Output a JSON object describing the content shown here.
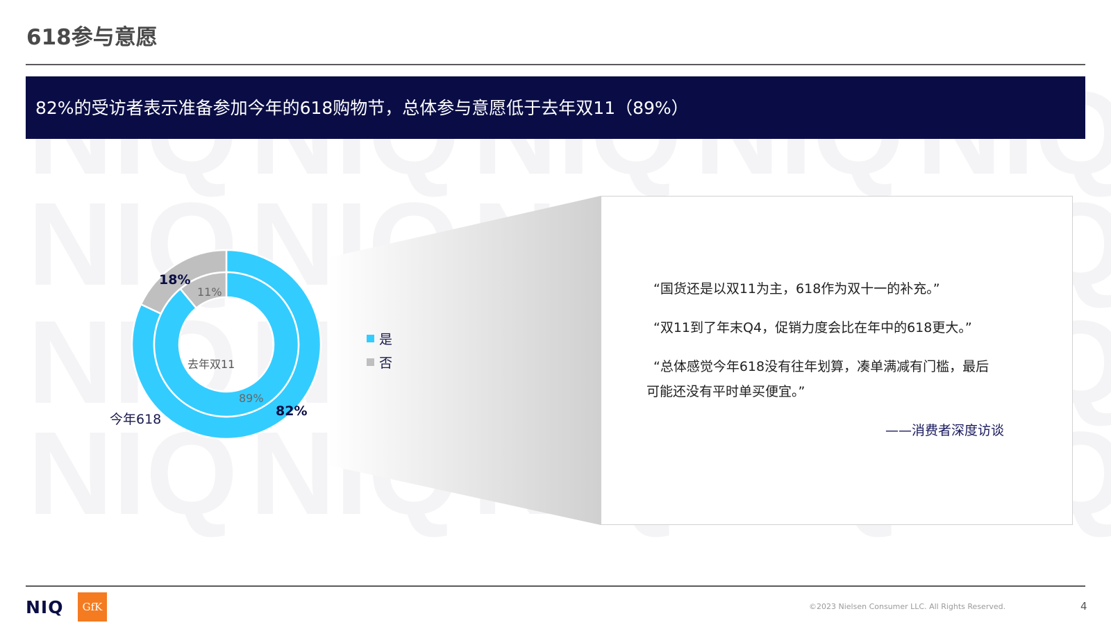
{
  "page": {
    "title": "618参与意愿",
    "headline": "82%的受访者表示准备参加今年的618购物节，总体参与意愿低于去年双11（89%）",
    "copyright": "©2023 Nielsen Consumer LLC. All Rights Reserved.",
    "page_number": "4",
    "logos": {
      "niq": "NIQ",
      "gfk": "GfK"
    },
    "watermark_text": "NIQ"
  },
  "chart_data": {
    "type": "donut",
    "rings": [
      {
        "name": "今年618",
        "ring": "outer",
        "values": [
          82,
          18
        ],
        "labels": [
          "82%",
          "18%"
        ]
      },
      {
        "name": "去年双11",
        "ring": "inner",
        "values": [
          89,
          11
        ],
        "labels": [
          "89%",
          "11%"
        ]
      }
    ],
    "categories": [
      "是",
      "否"
    ],
    "colors": {
      "是": "#33ccff",
      "否": "#bfbfbf"
    }
  },
  "legend": [
    {
      "label": "是",
      "color": "#33ccff"
    },
    {
      "label": "否",
      "color": "#bfbfbf"
    }
  ],
  "quotes": [
    "“国货还是以双11为主，618作为双十一的补充。”",
    "“双11到了年末Q4，促销力度会比在年中的618更大。”",
    "“总体感觉今年618没有往年划算，凑单满减有门槛，最后",
    "可能还没有平时单买便宜。”"
  ],
  "attribution": "——消费者深度访谈",
  "colors": {
    "navy": "#0a0d45",
    "accent": "#33ccff",
    "gray": "#bfbfbf",
    "gfk_orange": "#f47b20"
  }
}
